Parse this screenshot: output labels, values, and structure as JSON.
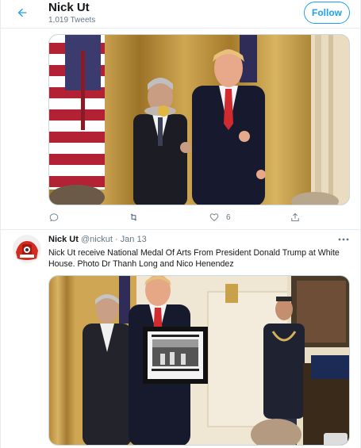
{
  "header": {
    "title": "Nick Ut",
    "tweet_count": "1,019 Tweets",
    "follow_label": "Follow",
    "back_icon": "arrow-left-icon"
  },
  "tweet1": {
    "replies": "",
    "retweets": "",
    "likes": "6",
    "icons": [
      "reply-icon",
      "retweet-icon",
      "like-icon",
      "share-icon"
    ]
  },
  "tweet2": {
    "name": "Nick Ut",
    "handle": "@nickut",
    "separator": "·",
    "date": "Jan 13",
    "text": "Nick Ut receive  National Medal Of Arts From President Donald Trump at White House. Photo Dr Thanh Long and Nico Henendez",
    "more_icon": "more-icon"
  },
  "colors": {
    "accent": "#1da1f2",
    "text": "#14171a",
    "muted": "#657786",
    "border": "#e6ecf0"
  }
}
